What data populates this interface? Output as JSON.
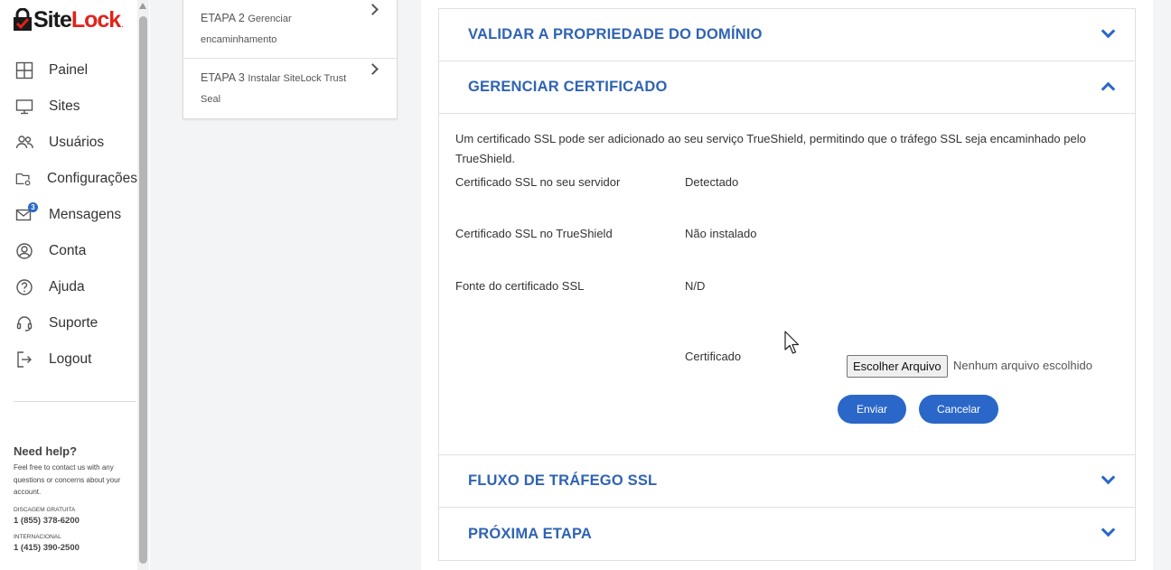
{
  "brand": {
    "name_a": "Site",
    "name_b": "Lock",
    "dot": "."
  },
  "nav": [
    {
      "label": "Painel",
      "icon": "grid-icon"
    },
    {
      "label": "Sites",
      "icon": "monitor-icon"
    },
    {
      "label": "Usuários",
      "icon": "users-icon"
    },
    {
      "label": "Configurações",
      "icon": "folder-settings-icon"
    },
    {
      "label": "Mensagens",
      "icon": "mail-icon",
      "badge": "3"
    },
    {
      "label": "Conta",
      "icon": "account-icon"
    },
    {
      "label": "Ajuda",
      "icon": "help-icon"
    },
    {
      "label": "Suporte",
      "icon": "headset-icon"
    },
    {
      "label": "Logout",
      "icon": "logout-icon"
    }
  ],
  "help": {
    "title": "Need help?",
    "text": "Feel free to contact us with any questions or concerns about your account.",
    "tollfree_label": "DISCAGEM GRATUITA",
    "tollfree_number": "1 (855) 378-6200",
    "intl_label": "INTERNACIONAL",
    "intl_number": "1 (415) 390-2500"
  },
  "steps": [
    {
      "prefix": "ETAPA 2",
      "text": "Gerenciar encaminhamento"
    },
    {
      "prefix": "ETAPA 3",
      "text": "Instalar SiteLock Trust Seal"
    }
  ],
  "sections": {
    "validate": "VALIDAR A PROPRIEDADE DO DOMÍNIO",
    "manage": "GERENCIAR CERTIFICADO",
    "traffic": "FLUXO DE TRÁFEGO SSL",
    "next": "PRÓXIMA ETAPA"
  },
  "certificate": {
    "description": "Um certificado SSL pode ser adicionado ao seu serviço TrueShield, permitindo que o tráfego SSL seja encaminhado pelo TrueShield.",
    "rows": [
      {
        "label": "Certificado SSL no seu servidor",
        "value": "Detectado"
      },
      {
        "label": "Certificado SSL no TrueShield",
        "value": "Não instalado"
      },
      {
        "label": "Fonte do certificado SSL",
        "value": "N/D"
      }
    ],
    "file_label": "Certificado",
    "file_button": "Escolher Arquivo",
    "file_status": "Nenhum arquivo escolhido",
    "submit": "Enviar",
    "cancel": "Cancelar"
  },
  "colors": {
    "accent": "#2a67c9",
    "title_blue": "#2f63b4",
    "brand_red": "#e2231a"
  }
}
